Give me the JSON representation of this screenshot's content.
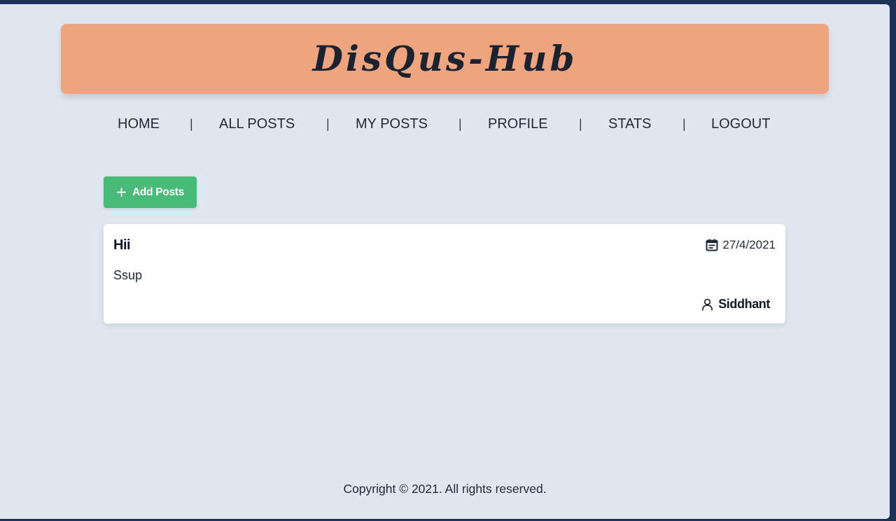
{
  "app": {
    "title": "DisQus-Hub"
  },
  "nav": {
    "items": [
      {
        "label": "HOME"
      },
      {
        "label": "ALL POSTS"
      },
      {
        "label": "MY POSTS"
      },
      {
        "label": "PROFILE"
      },
      {
        "label": "STATS"
      },
      {
        "label": "LOGOUT"
      }
    ],
    "separator": "|"
  },
  "actions": {
    "add_post_label": "Add Posts",
    "add_post_icon": "plus-icon"
  },
  "posts": [
    {
      "title": "Hii",
      "date": "27/4/2021",
      "date_icon": "calendar-icon",
      "body": "Ssup",
      "author": "Siddhant",
      "author_icon": "user-icon"
    }
  ],
  "footer": {
    "text": "Copyright © 2021. All rights reserved."
  },
  "colors": {
    "banner": "#efa480",
    "background": "#e0e7f0",
    "outer": "#1f3256",
    "accent_button": "#48bb78",
    "card": "#ffffff"
  }
}
